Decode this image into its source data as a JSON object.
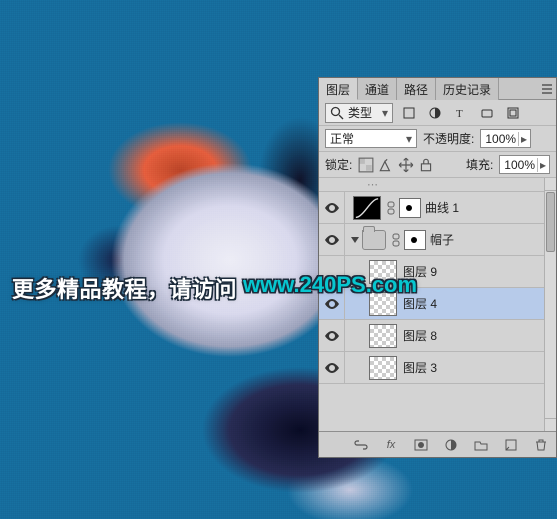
{
  "panel": {
    "tabs": [
      "图层",
      "通道",
      "路径",
      "历史记录"
    ],
    "active_tab": 0,
    "filter": {
      "label": "类型",
      "search_icon": "search-icon"
    },
    "blend_mode": "正常",
    "opacity_label": "不透明度:",
    "opacity_value": "100%",
    "lock_label": "锁定:",
    "fill_label": "填充:",
    "fill_value": "100%",
    "layers": [
      {
        "kind": "ellipsis"
      },
      {
        "kind": "adjustment",
        "visible": true,
        "name": "曲线 1",
        "has_mask": true
      },
      {
        "kind": "group",
        "visible": true,
        "name": "帽子",
        "expanded": true
      },
      {
        "kind": "layer",
        "visible": false,
        "name": "图层 9",
        "indent": 1
      },
      {
        "kind": "layer",
        "visible": true,
        "name": "图层 4",
        "indent": 1,
        "selected": true
      },
      {
        "kind": "layer",
        "visible": true,
        "name": "图层 8",
        "indent": 1
      },
      {
        "kind": "layer",
        "visible": true,
        "name": "图层 3",
        "indent": 1
      }
    ],
    "footer_icons": [
      "link-icon",
      "fx-icon",
      "mask-icon",
      "fill-adjust-icon",
      "group-icon",
      "new-layer-icon",
      "trash-icon"
    ]
  },
  "watermark": {
    "text_a": "更多精品教程，请访问",
    "text_b": "www.240PS.com"
  }
}
